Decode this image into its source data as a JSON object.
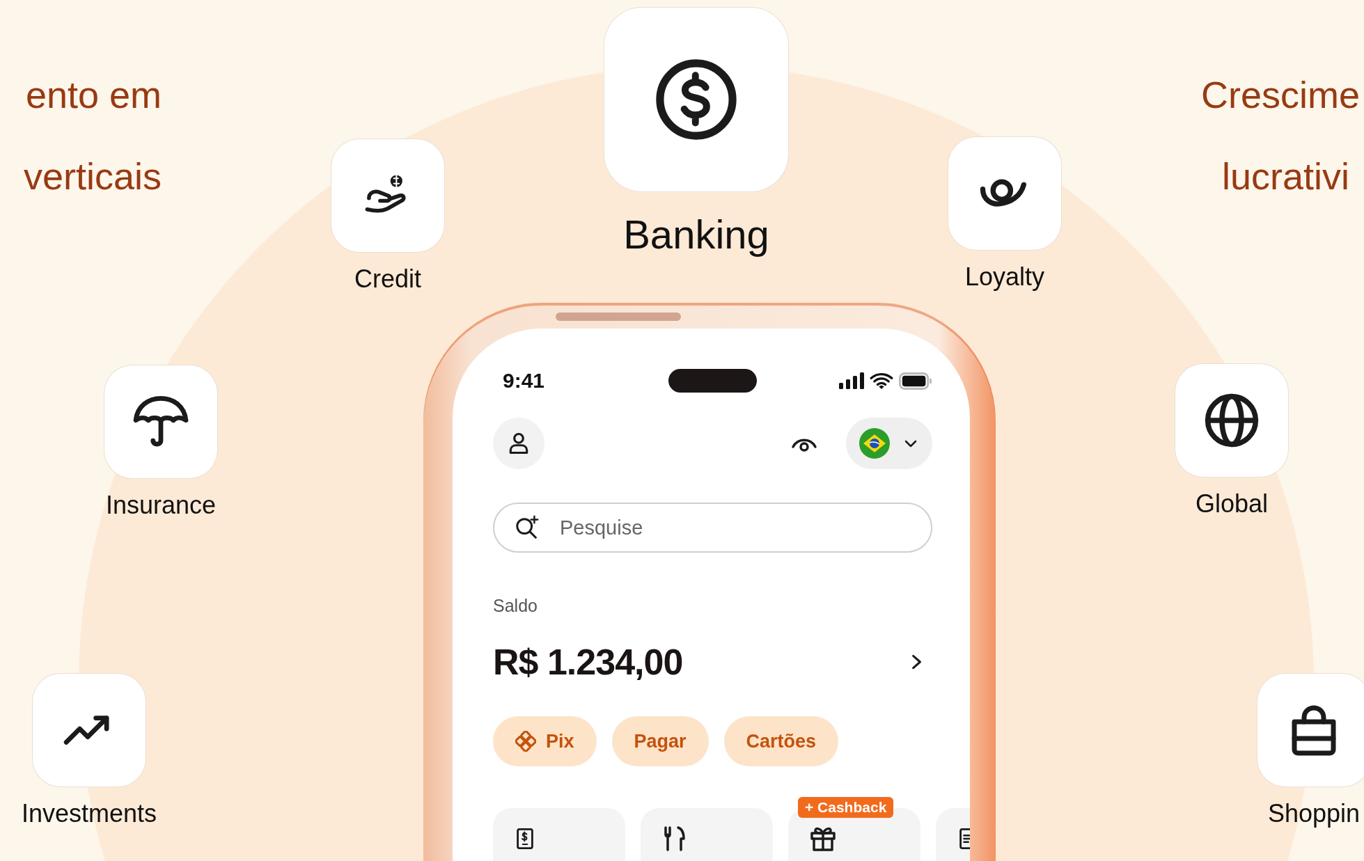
{
  "headings": [
    {
      "lines": [
        "ento em",
        "verticais"
      ]
    },
    {
      "lines": [
        "Crescime",
        "lucrativi"
      ]
    }
  ],
  "features": [
    {
      "kind": "banking",
      "label": "Banking"
    },
    {
      "kind": "credit",
      "label": "Credit"
    },
    {
      "kind": "loyalty",
      "label": "Loyalty"
    },
    {
      "kind": "insurance",
      "label": "Insurance"
    },
    {
      "kind": "global",
      "label": "Global"
    },
    {
      "kind": "investments",
      "label": "Investments"
    },
    {
      "kind": "shopping",
      "label": "Shoppin"
    }
  ],
  "phone": {
    "status_bar": {
      "time": "9:41"
    },
    "search": {
      "placeholder": "Pesquise"
    },
    "balance": {
      "label": "Saldo",
      "amount": "R$ 1.234,00"
    },
    "actions": [
      {
        "label": "Pix",
        "icon": true
      },
      {
        "label": "Pagar",
        "icon": false
      },
      {
        "label": "Cartões",
        "icon": false
      }
    ],
    "shortcuts": [
      {
        "kind": "receipt"
      },
      {
        "kind": "food"
      },
      {
        "kind": "gift",
        "badge": "+ Cashback"
      },
      {
        "kind": "document"
      }
    ]
  }
}
